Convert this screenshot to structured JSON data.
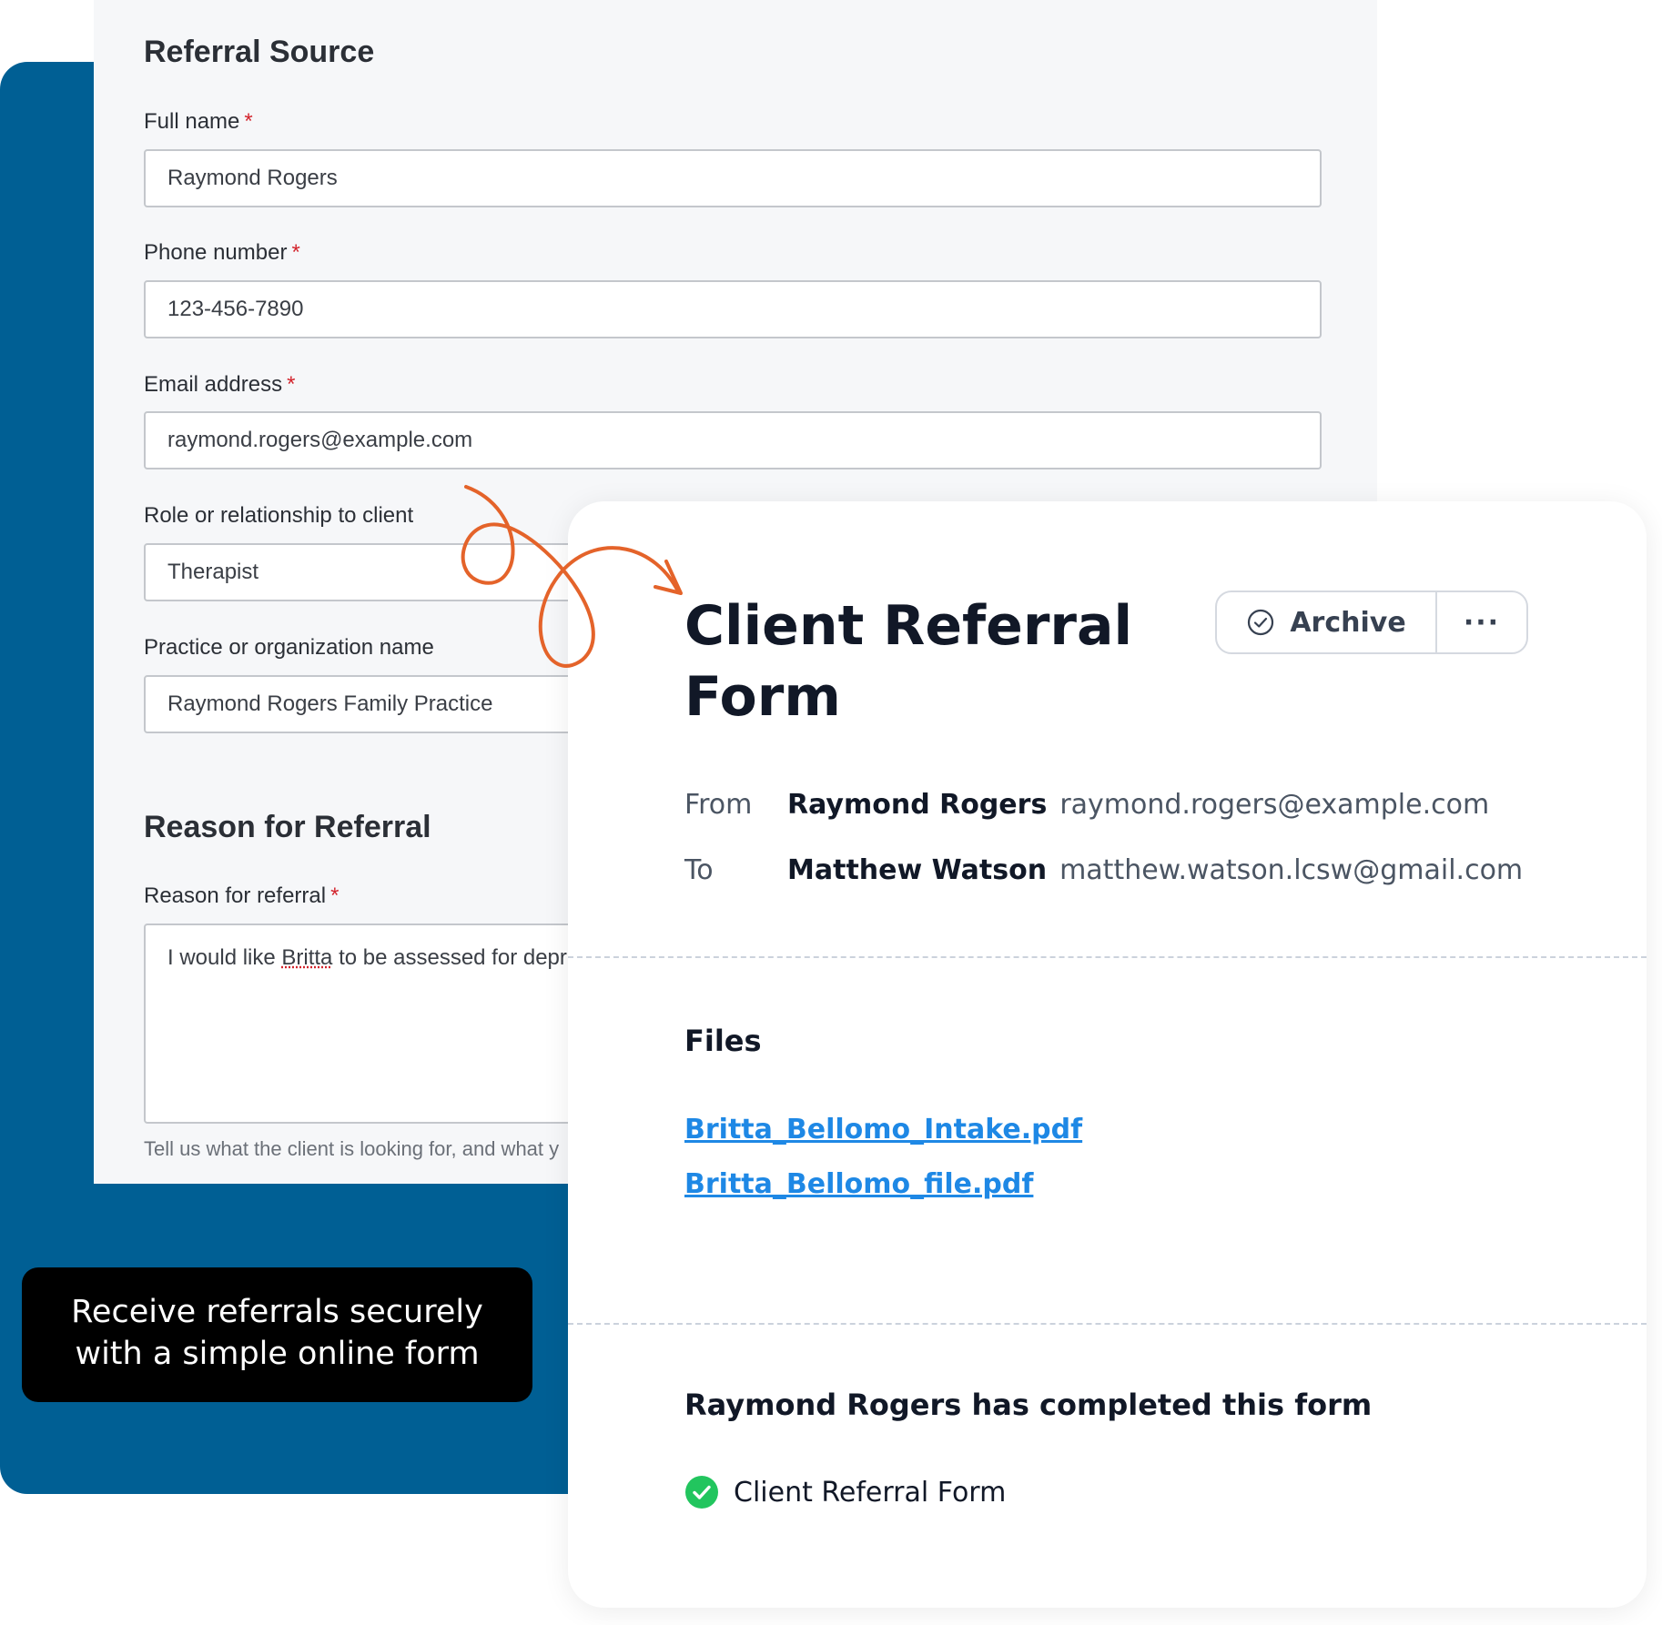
{
  "colors": {
    "brand_blue": "#005f94",
    "accent_orange": "#e4632a",
    "link_blue": "#1e88e5",
    "success_green": "#22c55e"
  },
  "referral_form": {
    "referral_source_heading": "Referral Source",
    "required_marker": "*",
    "fields": [
      {
        "label": "Full name",
        "value": "Raymond Rogers",
        "required": true
      },
      {
        "label": "Phone number",
        "value": "123-456-7890",
        "required": true
      },
      {
        "label": "Email address",
        "value": "raymond.rogers@example.com",
        "required": true
      },
      {
        "label": "Role or relationship to client",
        "value": "Therapist",
        "required": false
      },
      {
        "label": "Practice or organization name",
        "value": "Raymond Rogers Family Practice",
        "required": false
      }
    ],
    "reason_heading": "Reason for Referral",
    "reason_field": {
      "label": "Reason for referral",
      "required": true,
      "value_before": "I would like ",
      "value_flagged_word": "Britta",
      "value_after": " to be assessed for depr",
      "helper_text": "Tell us what the client is looking for, and what y"
    }
  },
  "caption": {
    "line1": "Receive referrals securely",
    "line2": "with a simple online form"
  },
  "detail": {
    "title_line1": "Client Referral",
    "title_line2": "Form",
    "archive_label": "Archive",
    "archive_icon": "check-circle-icon",
    "more_label": "···",
    "from": {
      "key": "From",
      "name": "Raymond Rogers",
      "email": "raymond.rogers@example.com"
    },
    "to": {
      "key": "To",
      "name": "Matthew Watson",
      "email": "matthew.watson.lcsw@gmail.com"
    },
    "files_heading": "Files",
    "files": [
      "Britta_Bellomo_Intake.pdf",
      "Britta_Bellomo_file.pdf"
    ],
    "completed_heading": "Raymond Rogers has completed this form",
    "completed_item": {
      "icon": "green-check-icon",
      "label": "Client Referral Form"
    }
  }
}
